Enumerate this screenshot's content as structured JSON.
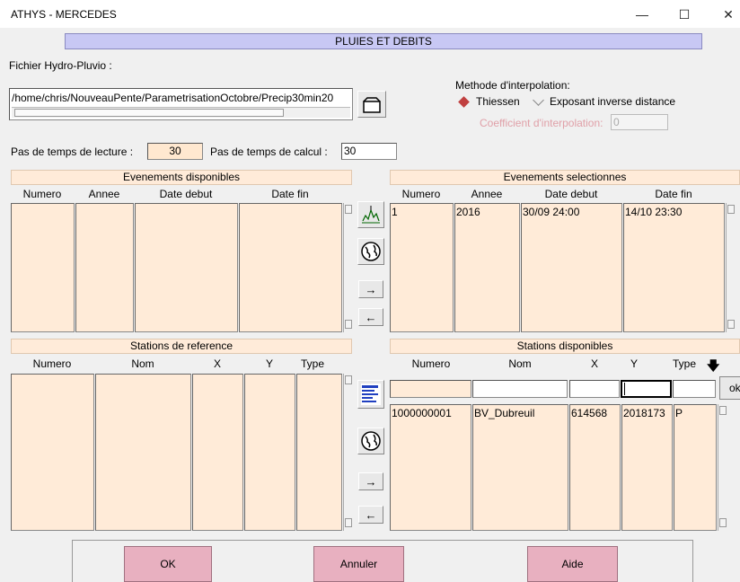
{
  "window": {
    "title": "ATHYS - MERCEDES",
    "minimize": "—",
    "maximize": "☐",
    "close": "✕"
  },
  "header": {
    "title": "PLUIES ET DEBITS"
  },
  "file": {
    "label": "Fichier Hydro-Pluvio :",
    "path": "/home/chris/NouveauPente/ParametrisationOctobre/Precip30min20"
  },
  "interpolation": {
    "label": "Methode d'interpolation:",
    "option1": "Thiessen",
    "option2": "Exposant inverse distance",
    "coef_label": "Coefficient d'interpolation:",
    "coef_value": "0"
  },
  "timestep": {
    "read_label": "Pas de temps de lecture :",
    "read_value": "30",
    "calc_label": "Pas de temps de calcul  :",
    "calc_value": "30"
  },
  "events_available": {
    "title": "Evenements disponibles",
    "columns": [
      "Numero",
      "Annee",
      "Date debut",
      "Date fin"
    ]
  },
  "events_selected": {
    "title": "Evenements selectionnes",
    "columns": [
      "Numero",
      "Annee",
      "Date debut",
      "Date fin"
    ],
    "row": {
      "numero": "1",
      "annee": "2016",
      "debut": "30/09 24:00",
      "fin": "14/10 23:30"
    }
  },
  "stations_reference": {
    "title": "Stations de reference",
    "columns": [
      "Numero",
      "Nom",
      "X",
      "Y",
      "Type"
    ]
  },
  "stations_available": {
    "title": "Stations disponibles",
    "columns": [
      "Numero",
      "Nom",
      "X",
      "Y",
      "Type"
    ],
    "sort_icon": "🡇",
    "ok": "ok",
    "row": {
      "numero": "1000000001",
      "nom": "BV_Dubreuil",
      "x": "614568",
      "y": "2018173",
      "type": "P"
    }
  },
  "buttons": {
    "ok": "OK",
    "cancel": "Annuler",
    "help": "Aide"
  },
  "icons": {
    "folder": "folder-icon",
    "chart": "hydrograph-icon",
    "globe": "globe-icon",
    "arrow_right": "→",
    "arrow_left": "←",
    "list": "list-icon"
  }
}
